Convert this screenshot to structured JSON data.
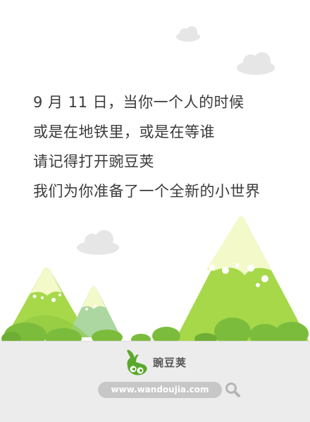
{
  "poem": {
    "lines": [
      "9 月 11 日，当你一个人的时候",
      "或是在地铁里，或是在等谁",
      "请记得打开豌豆荚",
      "我们为你准备了一个全新的小世界"
    ]
  },
  "footer": {
    "brand_name": "豌豆荚",
    "url": "www.wandoujia.com"
  },
  "icons": {
    "logo": "pea-pod-icon",
    "search": "search-icon",
    "cloud": "cloud-icon"
  },
  "colors": {
    "mountain_light_green": "#a6d84a",
    "mountain_dark_green": "#8cc63f",
    "snow_cap": "#f3f9c9",
    "tree_green": "#7cbc3c",
    "pale_mountain": "#acd7a0",
    "footer_bg": "#ececec",
    "cloud": "#e6e6e6",
    "text": "#3b3b3b",
    "brand_green": "#5aa82d"
  }
}
